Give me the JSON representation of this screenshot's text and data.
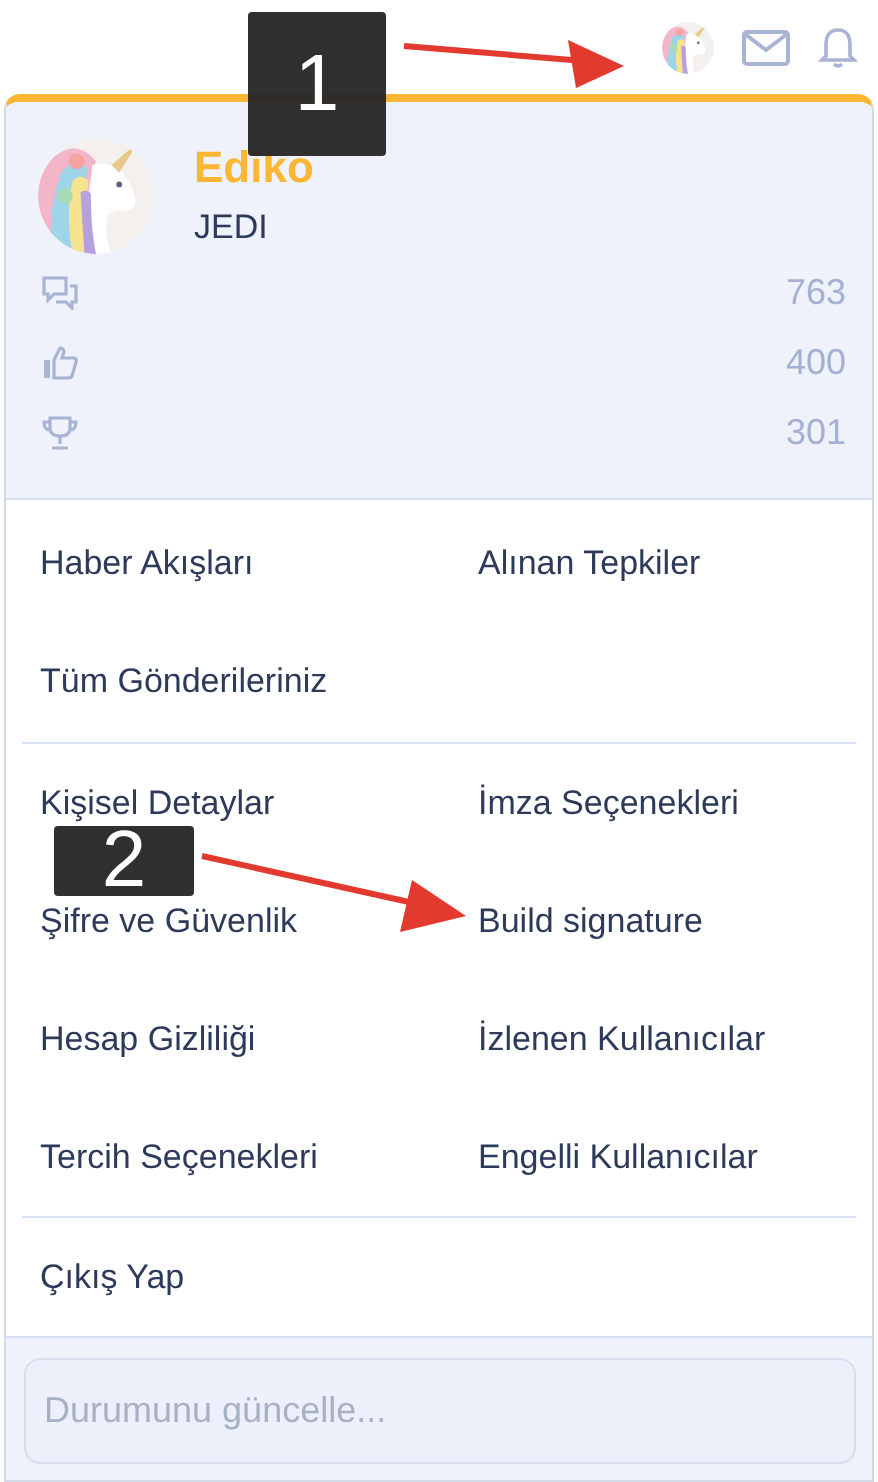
{
  "profile": {
    "name": "Ediko",
    "title": "JEDI",
    "stats": [
      {
        "kind": "messages",
        "value": "763"
      },
      {
        "kind": "reactions",
        "value": "400"
      },
      {
        "kind": "trophies",
        "value": "301"
      }
    ]
  },
  "menu_sections": [
    {
      "items": [
        {
          "label": "Haber Akışları"
        },
        {
          "label": "Alınan Tepkiler"
        },
        {
          "label": "Tüm Gönderileriniz"
        }
      ]
    },
    {
      "items": [
        {
          "label": "Kişisel Detaylar"
        },
        {
          "label": "İmza Seçenekleri"
        },
        {
          "label": "Şifre ve Güvenlik"
        },
        {
          "label": "Build signature"
        },
        {
          "label": "Hesap Gizliliği"
        },
        {
          "label": "İzlenen Kullanıcılar"
        },
        {
          "label": "Tercih Seçenekleri"
        },
        {
          "label": "Engelli Kullanıcılar"
        }
      ]
    },
    {
      "items": [
        {
          "label": "Çıkış Yap"
        }
      ]
    }
  ],
  "status_field": {
    "placeholder": "Durumunu güncelle..."
  },
  "annotations": [
    {
      "label": "1"
    },
    {
      "label": "2"
    }
  ]
}
